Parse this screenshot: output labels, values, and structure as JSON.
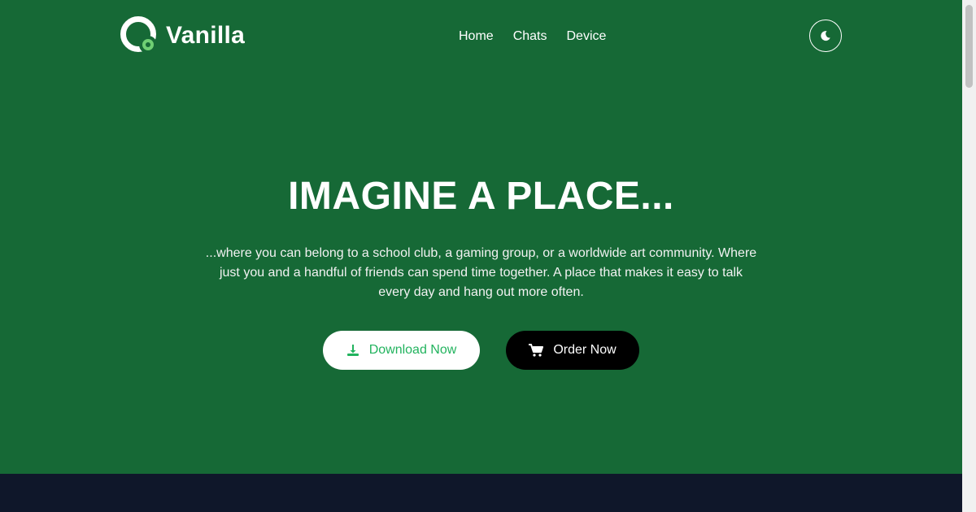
{
  "header": {
    "brand": "Vanilla",
    "nav": [
      "Home",
      "Chats",
      "Device"
    ],
    "theme_toggle_icon": "moon-icon"
  },
  "hero": {
    "title": "IMAGINE A PLACE...",
    "text": "...where you can belong to a school club, a gaming group, or a worldwide art community. Where just you and a handful of friends can spend time together. A place that makes it easy to talk every day and hang out more often.",
    "buttons": {
      "download": {
        "label": "Download Now",
        "icon": "download-icon"
      },
      "order": {
        "label": "Order Now",
        "icon": "cart-icon"
      }
    }
  },
  "colors": {
    "hero_bg": "#166936",
    "footer_bg": "#0f172a",
    "accent_green": "#22b35e",
    "logo_dot": "#6fcf73"
  }
}
